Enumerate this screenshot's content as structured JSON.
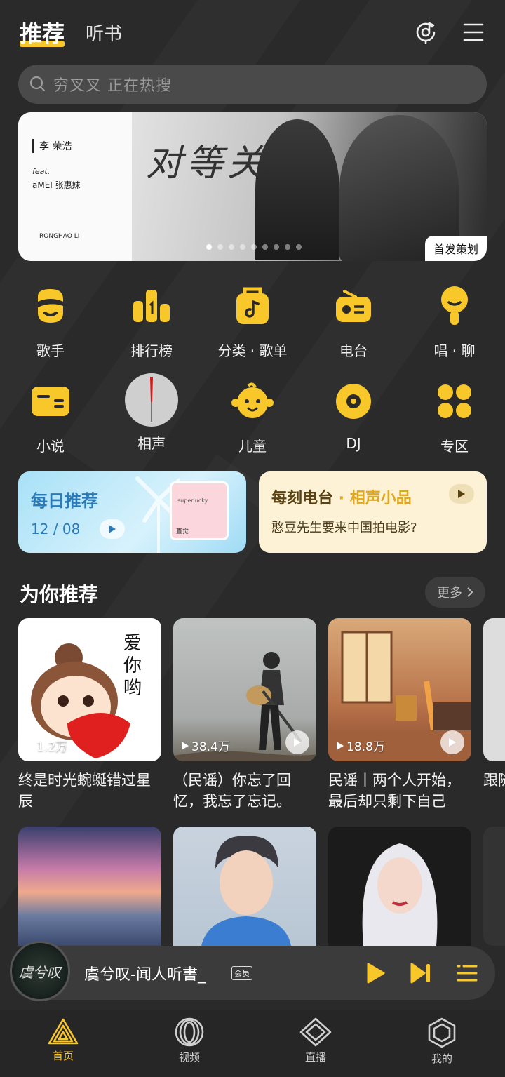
{
  "header": {
    "tab_active": "推荐",
    "tab_inactive": "听书"
  },
  "search": {
    "placeholder": "穷叉叉 正在热搜"
  },
  "banner": {
    "artist": "李 荣浩",
    "feat": "feat.",
    "featured": "aMEI   张惠妹",
    "signature": "RONGHAO LI",
    "title": "对等关系",
    "tag": "首发策划",
    "dots_count": 9,
    "active_dot": 0
  },
  "grid": [
    {
      "label": "歌手",
      "icon": "singer-icon"
    },
    {
      "label": "排行榜",
      "icon": "chart-icon"
    },
    {
      "label": "分类 · 歌单",
      "icon": "playlist-icon"
    },
    {
      "label": "电台",
      "icon": "radio-icon"
    },
    {
      "label": "唱 · 聊",
      "icon": "mic-icon"
    },
    {
      "label": "小说",
      "icon": "novel-icon"
    },
    {
      "label": "相声",
      "icon": "crosstalk-icon"
    },
    {
      "label": "儿童",
      "icon": "kids-icon"
    },
    {
      "label": "DJ",
      "icon": "dj-icon"
    },
    {
      "label": "专区",
      "icon": "zone-icon"
    }
  ],
  "daily": {
    "title": "每日推荐",
    "date": "12 / 08",
    "cover_text": "superlucky",
    "cover_tag": "直觉"
  },
  "radio": {
    "title": "每刻电台",
    "subtitle": " · 相声小品",
    "desc": "憨豆先生要来中国拍电影?"
  },
  "section": {
    "title": "为你推荐",
    "more": "更多"
  },
  "recommendations": [
    {
      "plays": "1.2万",
      "name": "终是时光蜿蜒错过星辰",
      "cover_text": "爱你哟"
    },
    {
      "plays": "38.4万",
      "name": "（民谣）你忘了回忆，我忘了忘记。"
    },
    {
      "plays": "18.8万",
      "name": "民谣丨两个人开始，最后却只剩下自己"
    },
    {
      "plays": "",
      "name": "跟随了方"
    }
  ],
  "player": {
    "title": "虞兮叹-闻人听書_",
    "vip": "会员",
    "disc_text": "虞兮叹"
  },
  "nav": [
    {
      "label": "首页",
      "active": true
    },
    {
      "label": "视频",
      "active": false
    },
    {
      "label": "直播",
      "active": false
    },
    {
      "label": "我的",
      "active": false
    }
  ],
  "colors": {
    "accent": "#f8c72a",
    "background": "#2a2a2a"
  }
}
